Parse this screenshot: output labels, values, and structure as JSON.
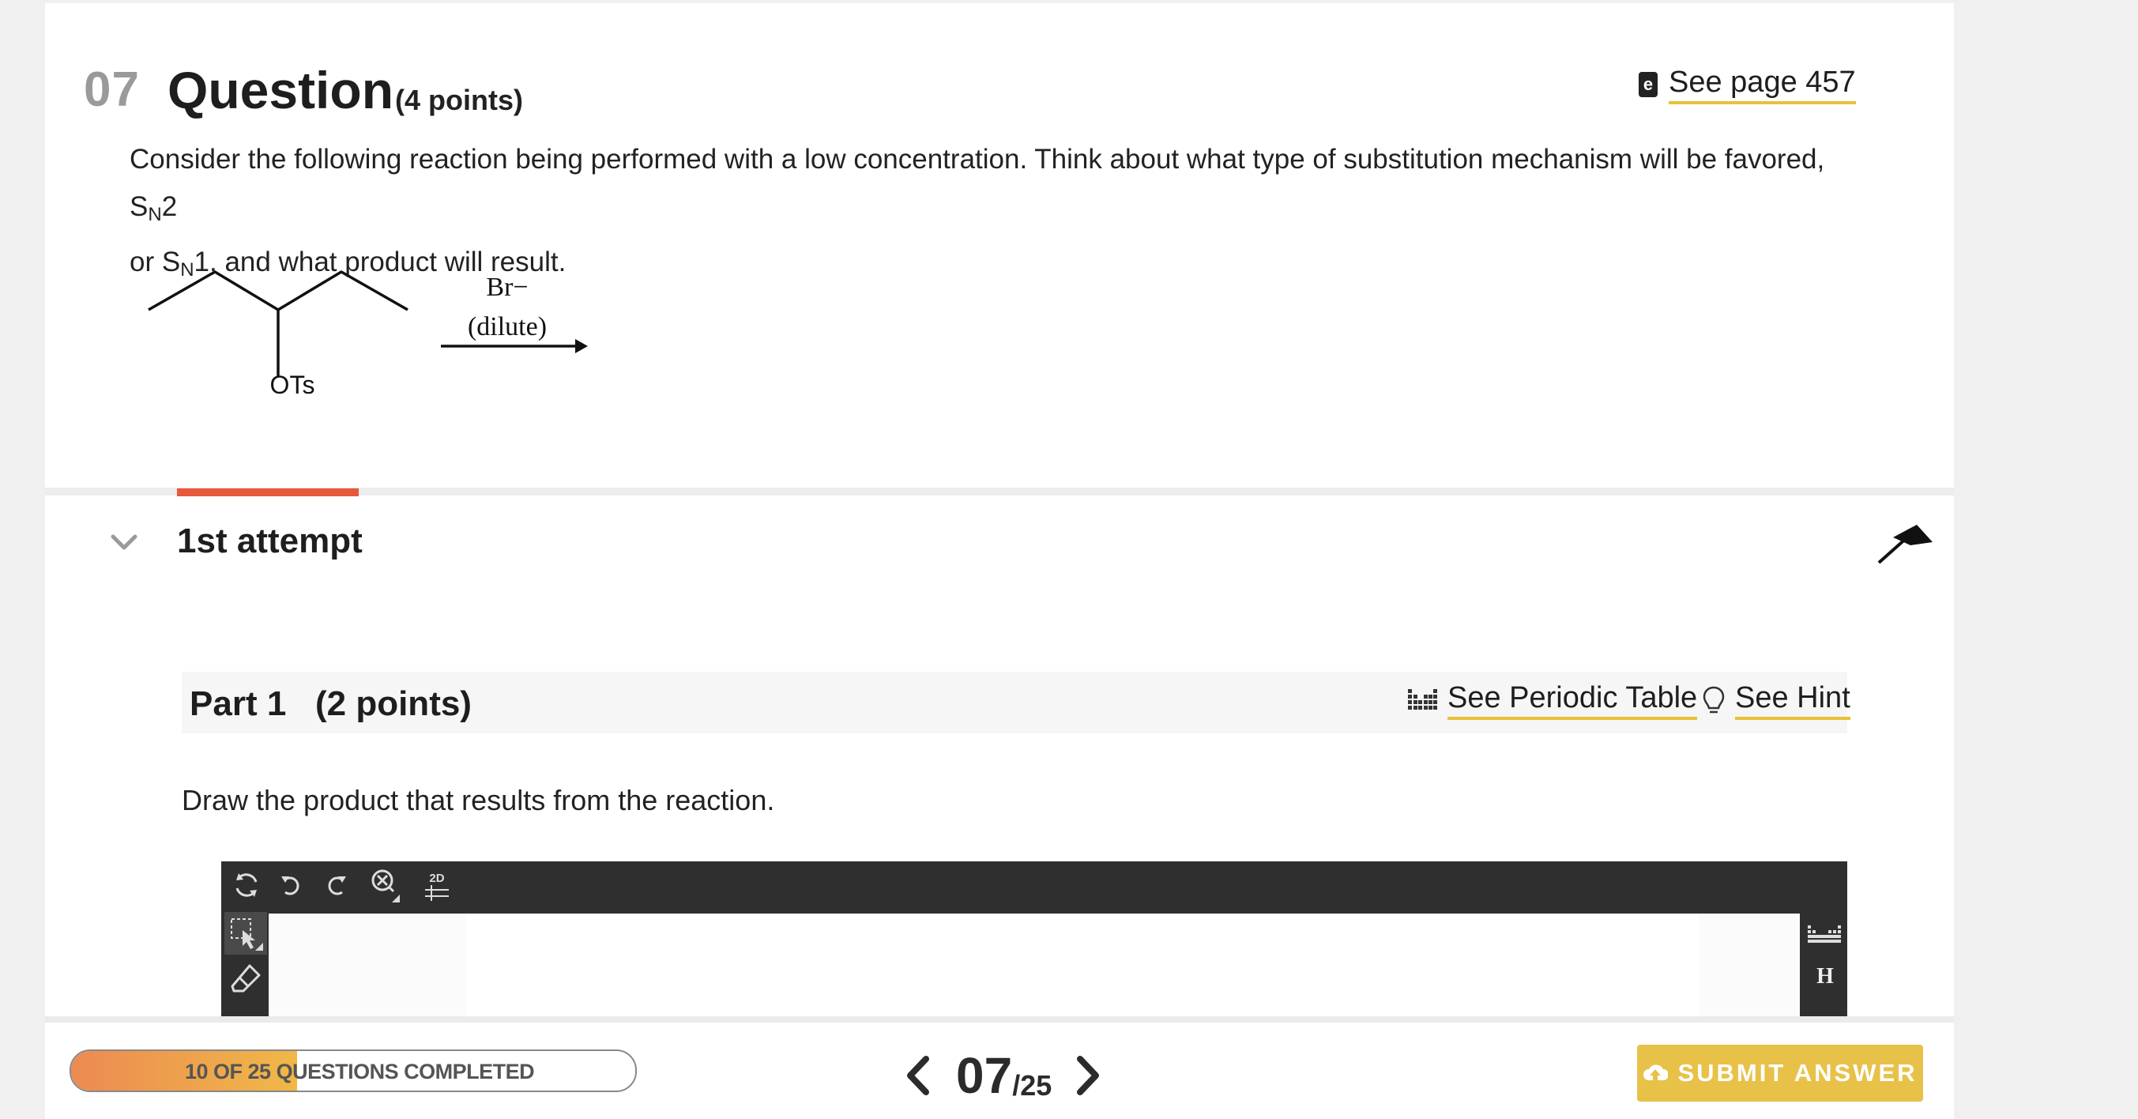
{
  "question": {
    "number": "07",
    "title": "Question",
    "points": "(4 points)",
    "see_page": "See page 457",
    "text_prefix": "Consider the following reaction being performed with a low concentration. Think about what type of substitution mechanism will be favored, S",
    "sub_n1": "N",
    "text_mid": "2",
    "text_line2_prefix": " or S",
    "sub_n2": "N",
    "text_suffix": "1, and what product will result.",
    "reaction": {
      "leaving_group": "OTs",
      "reagent": "Br−",
      "condition": "(dilute)"
    }
  },
  "attempt": {
    "label": "1st attempt"
  },
  "part": {
    "title": "Part 1",
    "points": "(2 points)",
    "periodic_table_link": "See Periodic Table",
    "hint_link": "See Hint",
    "instruction": "Draw the product that results from the reaction."
  },
  "editor": {
    "toolbar_2d_label": "2D",
    "hydrogen_label": "H"
  },
  "footer": {
    "progress_label": "10 OF 25 QUESTIONS COMPLETED",
    "progress_fraction": 0.4,
    "current": "07",
    "total": "/25",
    "submit_label": "SUBMIT ANSWER"
  },
  "colors": {
    "accent_yellow": "#e8c149",
    "tab_orange": "#e8583b",
    "editor_dark": "#2f2f2f"
  }
}
